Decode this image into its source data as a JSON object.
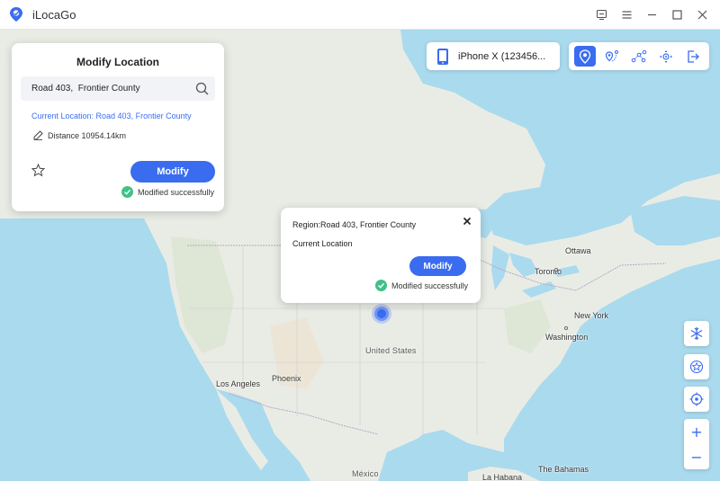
{
  "app": {
    "name": "iLocaGo"
  },
  "window_controls": [
    {
      "name": "feedback-icon"
    },
    {
      "name": "menu-icon"
    },
    {
      "name": "minimize-icon"
    },
    {
      "name": "maximize-icon"
    },
    {
      "name": "close-icon"
    }
  ],
  "modify_panel": {
    "title": "Modify Location",
    "search_value": "Road 403,  Frontier County",
    "current_location": "Current Location: Road 403, Frontier County",
    "distance": "Distance 10954.14km",
    "modify_label": "Modify",
    "success_text": "Modified successfully"
  },
  "device": {
    "label": "iPhone X (123456..."
  },
  "mode_toolbar": [
    "teleport-mode-icon",
    "two-spot-mode-icon",
    "multi-spot-mode-icon",
    "joystick-mode-icon",
    "exit-icon"
  ],
  "popup": {
    "region": "Region:Road 403, Frontier County",
    "subtitle": "Current Location",
    "modify_label": "Modify",
    "success_text": "Modified successfully"
  },
  "map_labels": {
    "ottawa": "Ottawa",
    "toronto": "Toronto",
    "new_york": "New York",
    "washington": "Washington",
    "united_states": "United States",
    "phoenix": "Phoenix",
    "los_angeles": "Los Angeles",
    "mexico": "México",
    "la_habana": "La Habana",
    "bahamas": "The Bahamas"
  },
  "right_tools": [
    "freeze-icon",
    "favorites-icon",
    "locate-icon"
  ],
  "zoom": {
    "in": "+",
    "out": "−"
  },
  "colors": {
    "accent": "#3a6cf0",
    "success": "#40c18a",
    "water": "#aadaee",
    "land": "#e8ebe4"
  }
}
